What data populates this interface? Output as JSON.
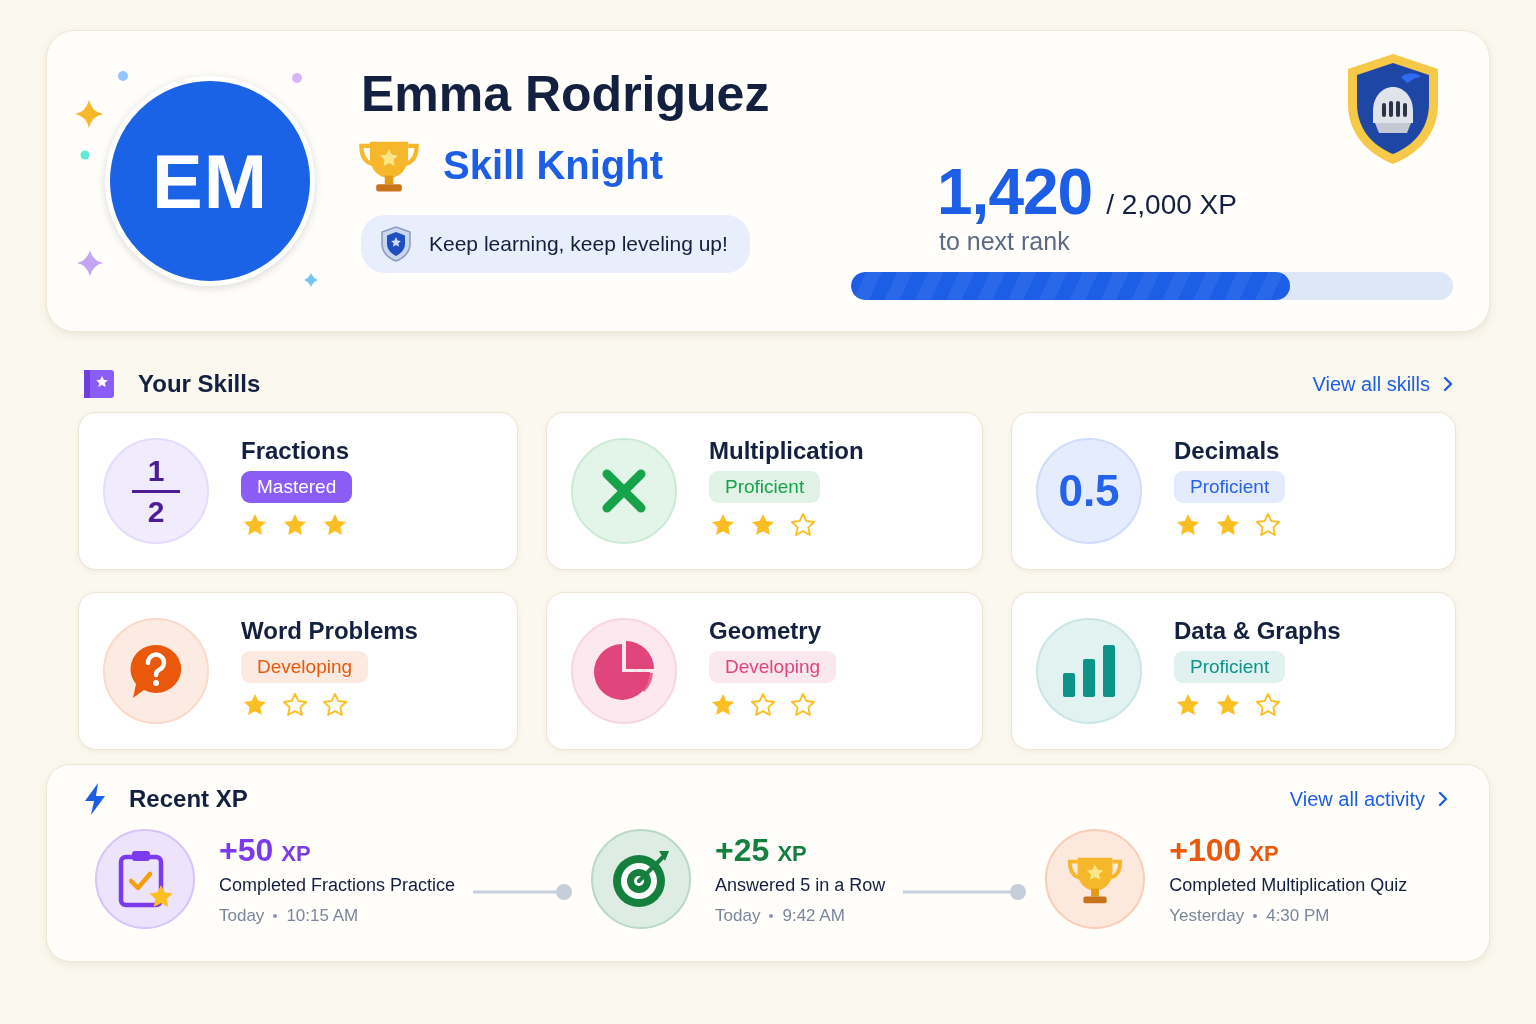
{
  "profile": {
    "initials": "EM",
    "name": "Emma Rodriguez",
    "rank": "Skill Knight",
    "motto": "Keep learning, keep leveling up!"
  },
  "xp": {
    "current": "1,420",
    "total": "/ 2,000 XP",
    "caption": "to next rank",
    "level": 0.73
  },
  "skills_section": {
    "title": "Your Skills",
    "link": "View all skills"
  },
  "skills": [
    {
      "name": "Fractions",
      "status": "Mastered",
      "solid": true,
      "color": "#8b5cf6",
      "stars": 3,
      "icon": {
        "kind": "fraction",
        "numerator": "1",
        "denominator": "2"
      }
    },
    {
      "name": "Multiplication",
      "status": "Proficient",
      "solid": false,
      "color": "#16a34a",
      "stars": 2,
      "icon": {
        "kind": "multiply"
      }
    },
    {
      "name": "Decimals",
      "status": "Proficient",
      "solid": false,
      "color": "#2563eb",
      "stars": 2,
      "icon": {
        "kind": "decimal",
        "text": "0.5"
      }
    },
    {
      "name": "Word Problems",
      "status": "Developing",
      "solid": false,
      "color": "#ea580c",
      "stars": 1,
      "icon": {
        "kind": "question"
      }
    },
    {
      "name": "Geometry",
      "status": "Developing",
      "solid": false,
      "color": "#e0457b",
      "stars": 1,
      "icon": {
        "kind": "pie"
      }
    },
    {
      "name": "Data & Graphs",
      "status": "Proficient",
      "solid": false,
      "color": "#0d9488",
      "stars": 2,
      "icon": {
        "kind": "bars"
      }
    }
  ],
  "recent_section": {
    "title": "Recent XP",
    "link": "View all activity"
  },
  "activity": [
    {
      "amount": "+50",
      "unit": "XP",
      "color": "#7c3aed",
      "text": "Completed Fractions Practice",
      "day": "Today",
      "time": "10:15 AM",
      "kind": "clipboard"
    },
    {
      "amount": "+25",
      "unit": "XP",
      "color": "#15803d",
      "text": "Answered 5 in a Row",
      "day": "Today",
      "time": "9:42 AM",
      "kind": "target"
    },
    {
      "amount": "+100",
      "unit": "XP",
      "color": "#ea580c",
      "text": "Completed Multiplication Quiz",
      "day": "Yesterday",
      "time": "4:30 PM",
      "kind": "trophy"
    }
  ]
}
